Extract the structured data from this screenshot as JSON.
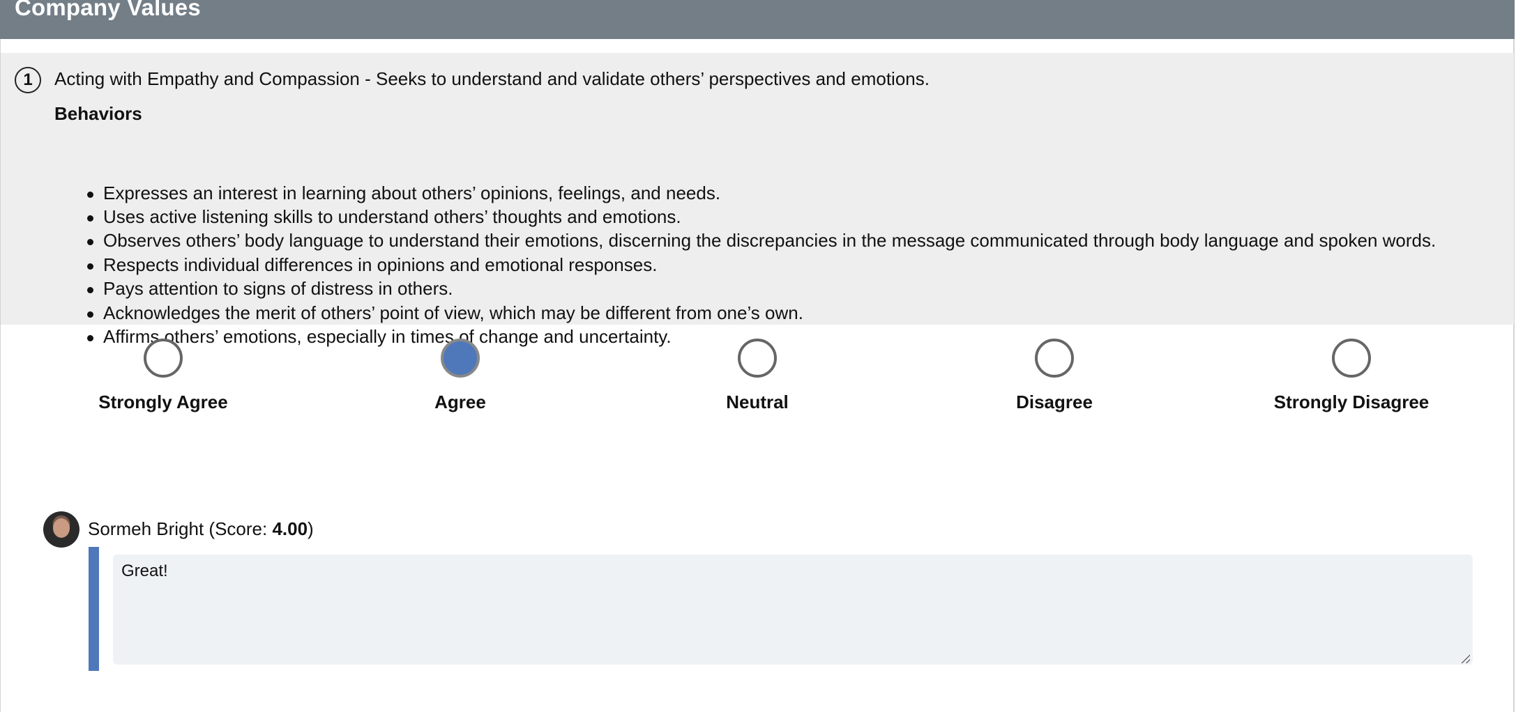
{
  "header": {
    "title": "Company Values"
  },
  "question": {
    "number": "1",
    "text": "Acting with Empathy and Compassion - Seeks to understand and validate others’ perspectives and emotions.",
    "behaviors_heading": "Behaviors",
    "behaviors": [
      "Expresses an interest in learning about others’ opinions, feelings, and needs.",
      "Uses active listening skills to understand others’ thoughts and emotions.",
      "Observes others’ body language to understand their emotions, discerning the discrepancies in the message communicated through body language and spoken words.",
      "Respects individual differences in opinions and emotional responses.",
      "Pays attention to signs of distress in others.",
      "Acknowledges the merit of others’ point of view, which may be different from one’s own.",
      "Affirms others’ emotions, especially in times of change and uncertainty."
    ]
  },
  "rating": {
    "options": [
      {
        "label": "Strongly Agree",
        "selected": false
      },
      {
        "label": "Agree",
        "selected": true
      },
      {
        "label": "Neutral",
        "selected": false
      },
      {
        "label": "Disagree",
        "selected": false
      },
      {
        "label": "Strongly Disagree",
        "selected": false
      }
    ],
    "selected_color": "#4f78bb"
  },
  "review": {
    "reviewer_name": "Sormeh Bright",
    "score_prefix": " (Score: ",
    "score": "4.00",
    "score_suffix": ")",
    "comment": "Great!",
    "accent_color": "#4f78bb"
  },
  "colors": {
    "header_bg": "#737e87",
    "question_bg": "#eeeeee",
    "comment_bg": "#eff2f5"
  }
}
